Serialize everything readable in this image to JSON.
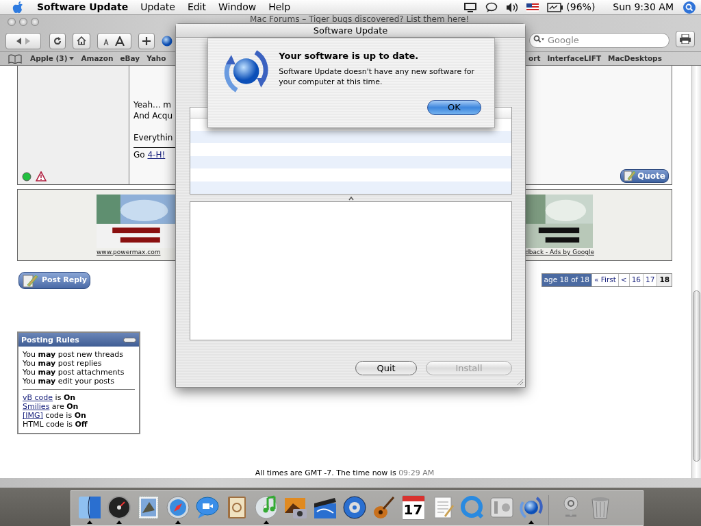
{
  "menu_bar": {
    "app": "Software Update",
    "items": [
      "Update",
      "Edit",
      "Window",
      "Help"
    ],
    "battery": "(96%)",
    "clock": "Sun 9:30 AM"
  },
  "browser": {
    "title": "Mac Forums – Tiger bugs discovered? List them here!",
    "search": {
      "placeholder": "Google"
    },
    "bookmarks_left": [
      {
        "label": "Apple (3)",
        "kind": "menu"
      },
      {
        "label": "Amazon",
        "kind": "link"
      },
      {
        "label": "eBay",
        "kind": "link"
      },
      {
        "label": "Yaho",
        "kind": "link"
      }
    ],
    "bookmarks_right": [
      {
        "label": "ort",
        "kind": "link"
      },
      {
        "label": "InterfaceLIFT",
        "kind": "link"
      },
      {
        "label": "MacDesktops",
        "kind": "link"
      }
    ],
    "post": {
      "online": true,
      "paragraphs": [
        [
          "Yeah... m",
          "And Acqu"
        ],
        [
          "Everythin"
        ]
      ],
      "signature_prefix": "Go",
      "signature_link": "4-H!",
      "quote_button": "Quote"
    },
    "ads": {
      "left_caption": "www.powermax.com",
      "right_caption": "dback - Ads by Google"
    },
    "post_reply_button": "Post Reply",
    "pagination": {
      "label": "age 18 of 18",
      "pages": [
        {
          "text": "« First",
          "selected": false
        },
        {
          "text": "<",
          "selected": false
        },
        {
          "text": "16",
          "selected": false
        },
        {
          "text": "17",
          "selected": false
        },
        {
          "text": "18",
          "selected": true
        }
      ]
    },
    "posting_rules": {
      "title": "Posting Rules",
      "rules": [
        "You **may** post new threads",
        "You **may** post replies",
        "You **may** post attachments",
        "You **may** edit your posts"
      ],
      "settings": [
        {
          "link": "vB code",
          "text": "is **On**"
        },
        {
          "link": "Smilies",
          "text": "are **On**"
        },
        {
          "link": "[IMG]",
          "text": "code is **On**"
        },
        {
          "text": "HTML code is **Off**"
        }
      ]
    },
    "footer": {
      "text": "All times are GMT -7. The time now is",
      "time": "09:29 AM"
    }
  },
  "dialog": {
    "title": "Software Update",
    "buttons": [
      {
        "label": "Quit",
        "disabled": false
      },
      {
        "label": "Install",
        "disabled": true
      }
    ]
  },
  "alert": {
    "heading": "Your software is up to date.",
    "message": "Software Update doesn't have any new software for your computer at this time.",
    "button": "OK"
  },
  "dock": {
    "apps": [
      {
        "kind": "finder",
        "running": true
      },
      {
        "kind": "dashboard",
        "running": true
      },
      {
        "kind": "mail",
        "running": false
      },
      {
        "kind": "safari",
        "running": true
      },
      {
        "kind": "ichat",
        "running": false
      },
      {
        "kind": "addressbook",
        "running": false
      },
      {
        "kind": "itunes",
        "running": true
      },
      {
        "kind": "iphoto",
        "running": false
      },
      {
        "kind": "imovie",
        "running": false
      },
      {
        "kind": "dvd",
        "running": false
      },
      {
        "kind": "garageband",
        "running": false
      },
      {
        "kind": "ical",
        "running": false,
        "label": "17"
      },
      {
        "kind": "textedit",
        "running": false
      },
      {
        "kind": "quicktime",
        "running": false
      },
      {
        "kind": "sysprefs",
        "running": false
      },
      {
        "kind": "swupdate",
        "running": true
      }
    ],
    "others": [
      {
        "kind": "spring",
        "running": false
      },
      {
        "kind": "trash",
        "running": false
      }
    ]
  }
}
